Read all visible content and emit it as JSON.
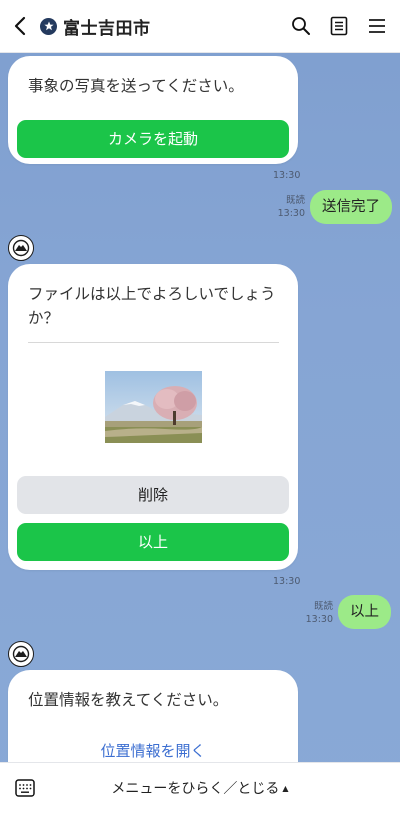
{
  "header": {
    "title": "富士吉田市",
    "back_icon": "chevron-left-icon",
    "badge_icon": "shield-star-icon",
    "actions": [
      "search-icon",
      "notes-icon",
      "hamburger-menu-icon"
    ]
  },
  "messages": {
    "camera_card": {
      "text": "事象の写真を送ってください。",
      "button_label": "カメラを起動",
      "time": "13:30"
    },
    "sent_complete": {
      "read_label": "既読",
      "time": "13:30",
      "text": "送信完了"
    },
    "confirm_card": {
      "text": "ファイルは以上でよろしいでしょうか？",
      "delete_label": "削除",
      "ok_label": "以上",
      "time": "13:30"
    },
    "sent_ok": {
      "read_label": "既読",
      "time": "13:30",
      "text": "以上"
    },
    "location_card": {
      "text": "位置情報を教えてください。",
      "link_label": "位置情報を開く"
    }
  },
  "footer": {
    "menu_label": "メニューをひらく／とじる",
    "caret": "▲",
    "keyboard_icon": "keyboard-icon"
  },
  "colors": {
    "accent_green": "#1bc549",
    "my_bubble": "#9cea88",
    "chat_bg": "#86a5d4",
    "link": "#3d6fd1"
  }
}
